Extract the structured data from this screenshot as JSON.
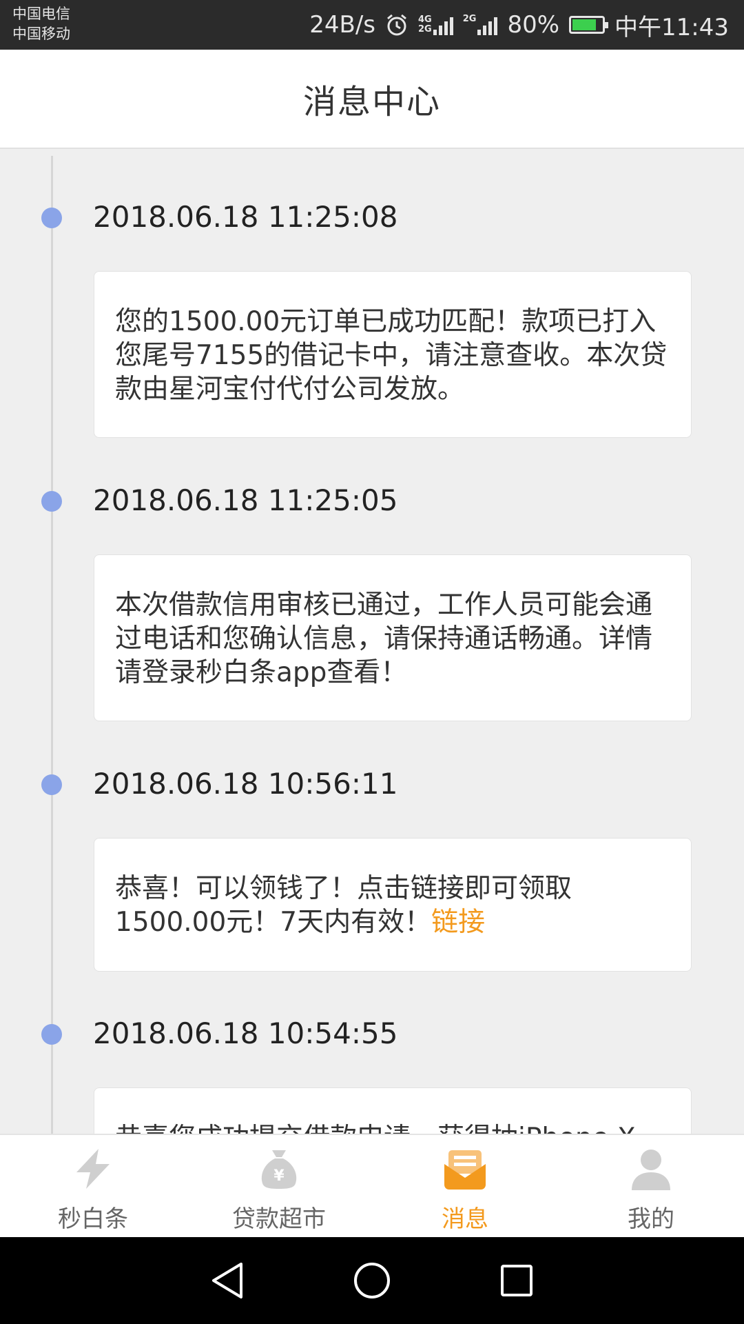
{
  "status_bar": {
    "carrier_1": "中国电信",
    "carrier_2": "中国移动",
    "net_speed": "24B/s",
    "network_1": "4G",
    "network_1b": "2G",
    "network_2": "2G",
    "battery": "80%",
    "battery_level": 0.8,
    "time": "中午11:43"
  },
  "header": {
    "title": "消息中心"
  },
  "messages": [
    {
      "time": "2018.06.18 11:25:08",
      "text": "您的1500.00元订单已成功匹配！款项已打入您尾号7155的借记卡中，请注意查收。本次贷款由星河宝付代付公司发放。"
    },
    {
      "time": "2018.06.18 11:25:05",
      "text": "本次借款信用审核已通过，工作人员可能会通过电话和您确认信息，请保持通话畅通。详情请登录秒白条app查看！"
    },
    {
      "time": "2018.06.18 10:56:11",
      "text": "恭喜！可以领钱了！点击链接即可领取1500.00元！7天内有效！",
      "link": "链接"
    },
    {
      "time": "2018.06.18 10:54:55",
      "text": "恭喜您成功提交借款申请，获得抽iPhone X"
    }
  ],
  "tabs": [
    {
      "label": "秒白条",
      "icon": "lightning-icon"
    },
    {
      "label": "贷款超市",
      "icon": "money-bag-icon"
    },
    {
      "label": "消息",
      "icon": "envelope-icon",
      "active": true
    },
    {
      "label": "我的",
      "icon": "person-icon"
    }
  ],
  "colors": {
    "accent": "#f39a1e",
    "timeline_dot": "#8aa4e8",
    "background": "#efefef"
  }
}
